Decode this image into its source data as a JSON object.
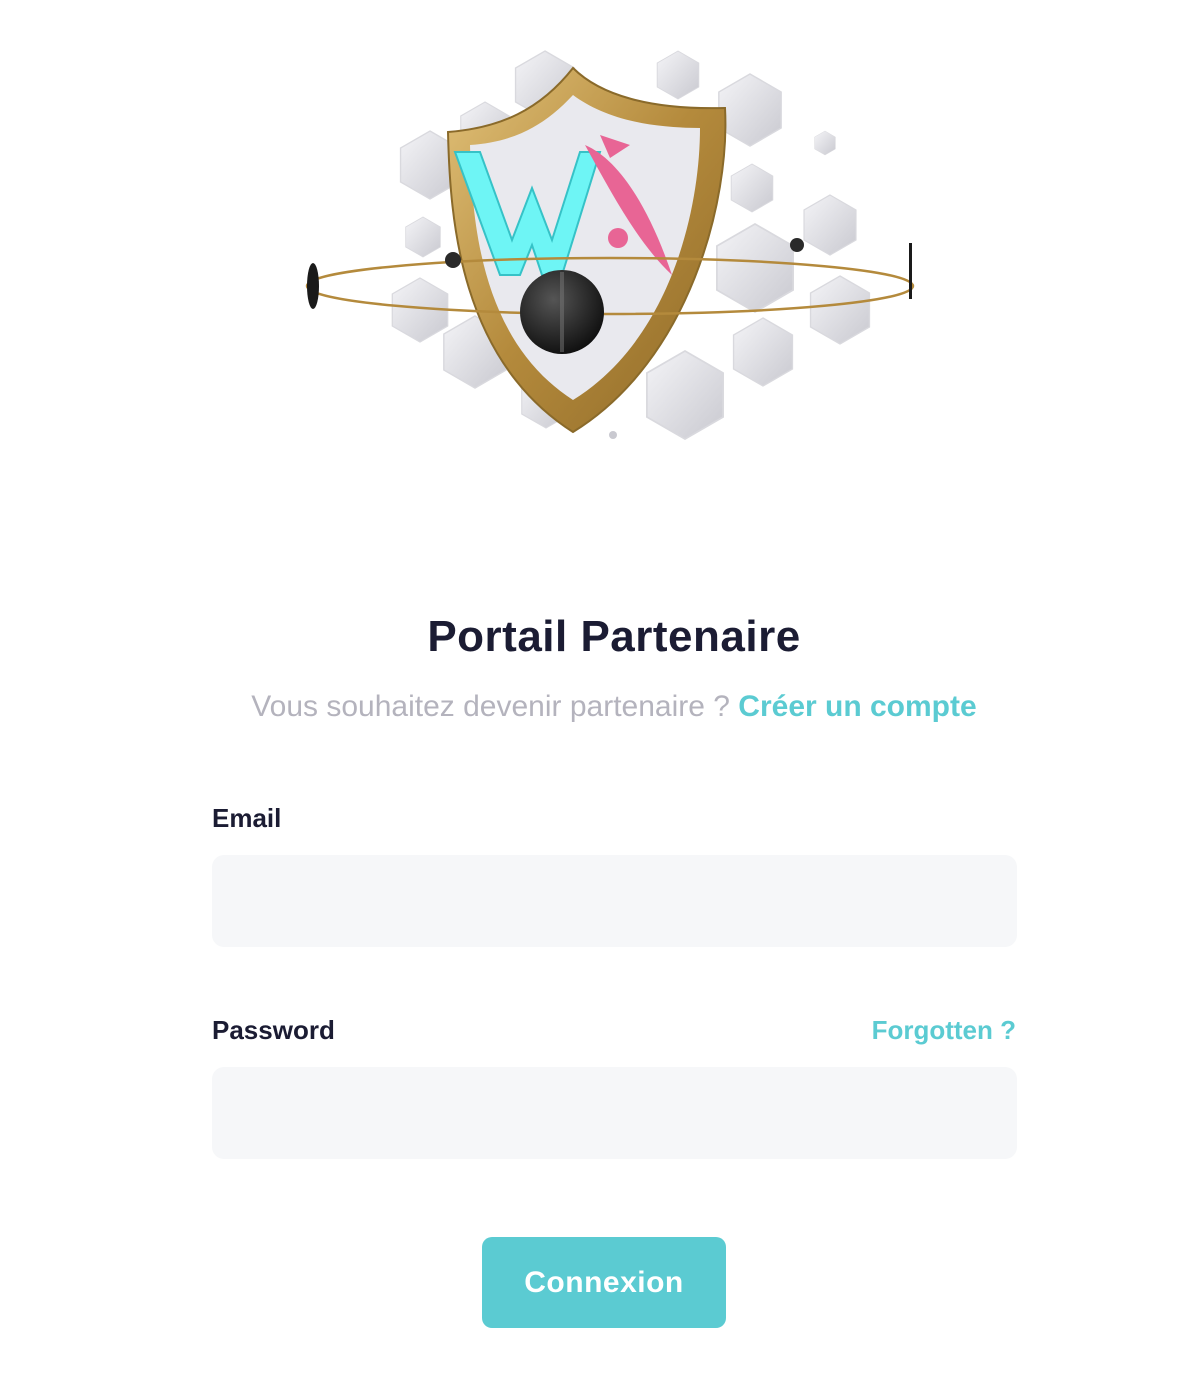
{
  "page": {
    "title": "Portail Partenaire",
    "subtitle_prefix": "Vous souhaitez devenir partenaire ? ",
    "signup_link": "Créer un compte"
  },
  "form": {
    "email_label": "Email",
    "email_value": "",
    "email_placeholder": "",
    "password_label": "Password",
    "password_value": "",
    "password_placeholder": "",
    "forgot_link": "Forgotten ?",
    "submit_label": "Connexion"
  },
  "colors": {
    "accent": "#5bcbd2",
    "title": "#1b1c33",
    "muted": "#b4b3bd",
    "field_bg": "#f6f7f9",
    "logo_cyan": "#6ef5f5",
    "logo_pink": "#e86595",
    "shield_gold": "#c9a253"
  },
  "icons": {
    "hero": "shield-logo-illustration"
  }
}
